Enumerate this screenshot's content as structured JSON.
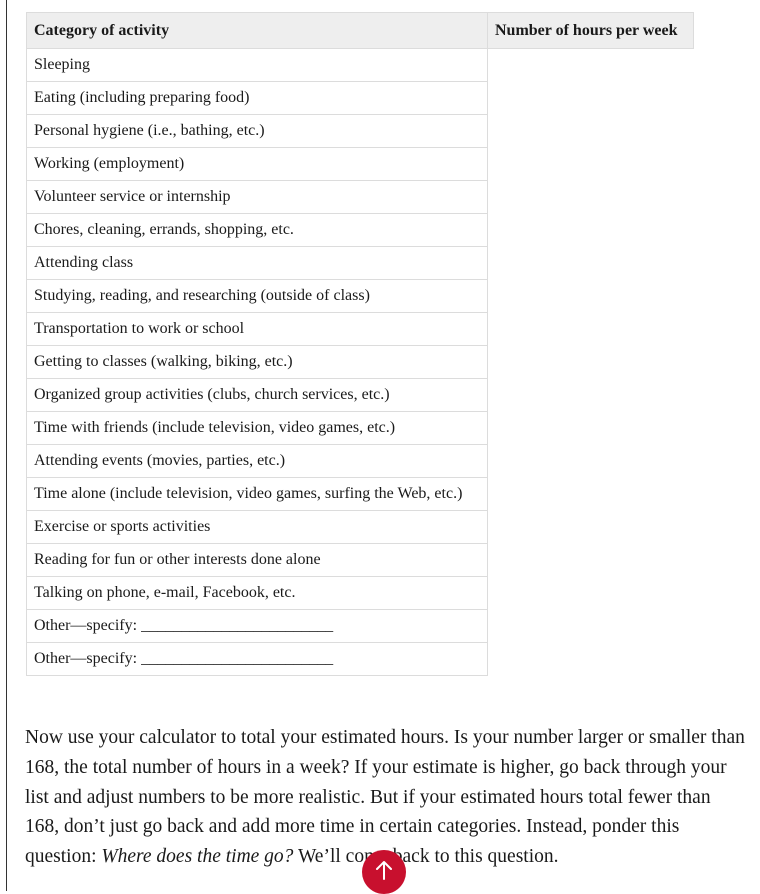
{
  "table": {
    "headers": [
      "Category of activity",
      "Number of hours per week"
    ],
    "rows": [
      "Sleeping",
      "Eating (including preparing food)",
      "Personal hygiene (i.e., bathing, etc.)",
      "Working (employment)",
      "Volunteer service or internship",
      "Chores, cleaning, errands, shopping, etc.",
      "Attending class",
      "Studying, reading, and researching (outside of class)",
      "Transportation to work or school",
      "Getting to classes (walking, biking, etc.)",
      "Organized group activities (clubs, church services, etc.)",
      "Time with friends (include television, video games, etc.)",
      "Attending events (movies, parties, etc.)",
      "Time alone (include television, video games, surfing the Web, etc.)",
      "Exercise or sports activities",
      "Reading for fun or other interests done alone",
      "Talking on phone, e-mail, Facebook, etc.",
      "Other—specify: ________________________",
      "Other—specify: ________________________"
    ]
  },
  "paragraph": {
    "text_before": "Now use your calculator to total your estimated hours. Is your number larger or smaller than 168, the total number of hours in a week? If your estimate is higher, go back through your list and adjust numbers to be more realistic. But if your estimated hours total fewer than 168, don’t just go back and add more time in certain categories. Instead, ponder this question: ",
    "emphasis": "Where does the time go?",
    "text_after": " We’ll come back to this question."
  },
  "back_to_top": {
    "icon": "arrow-up-icon",
    "color": "#c8102e"
  }
}
